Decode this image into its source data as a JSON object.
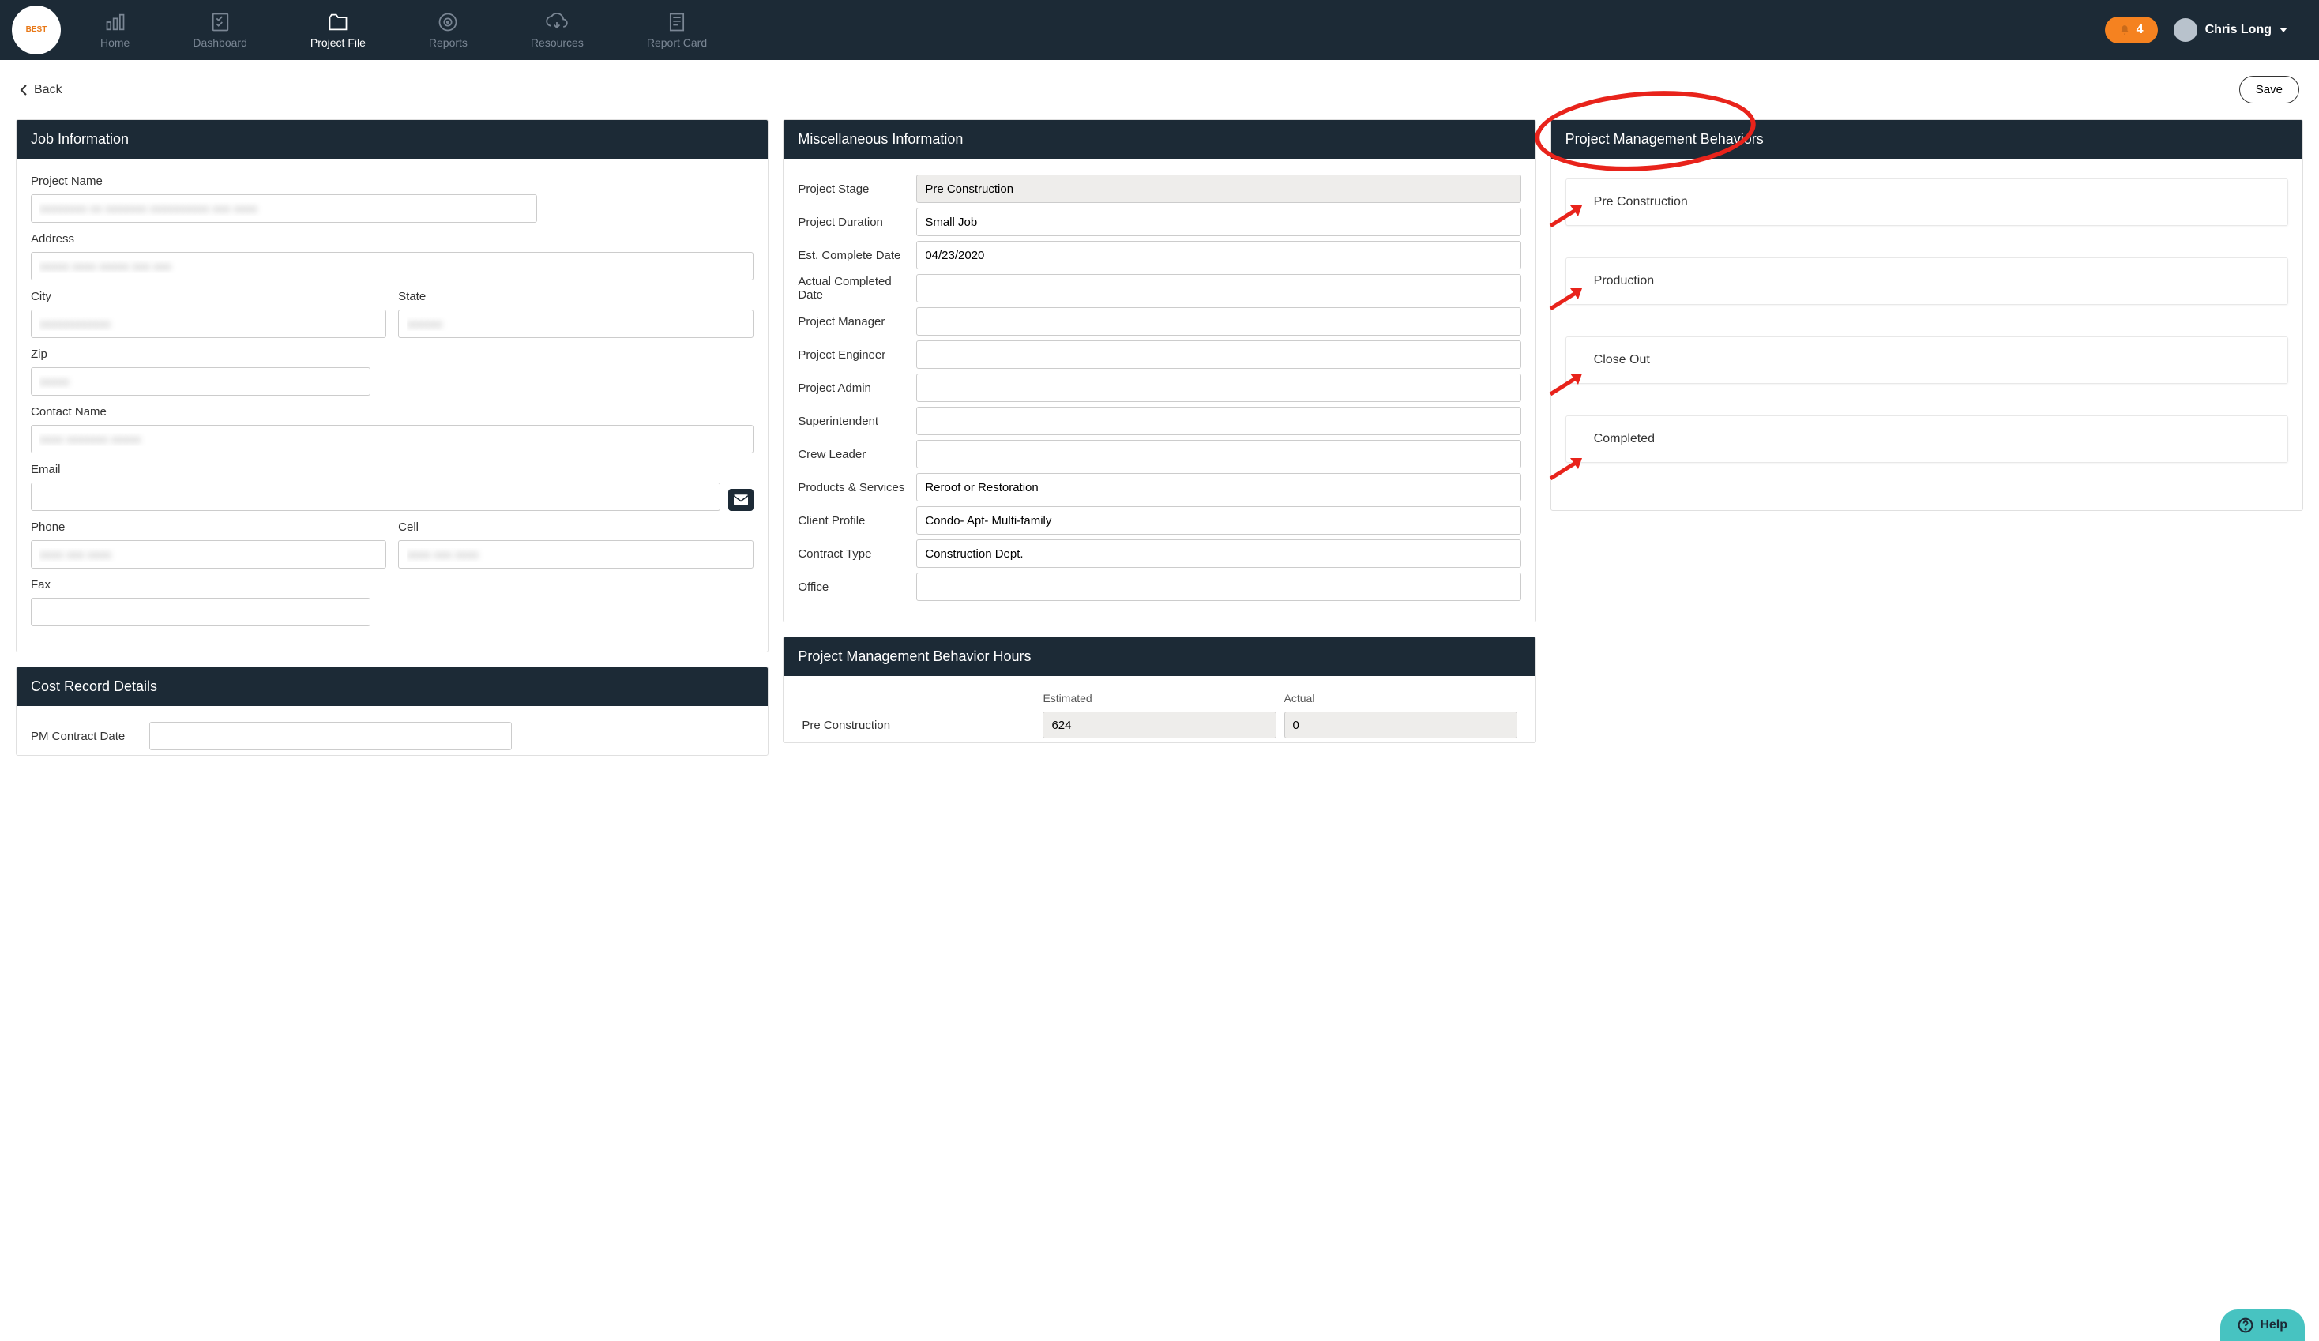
{
  "header": {
    "nav": [
      {
        "label": "Home",
        "active": false
      },
      {
        "label": "Dashboard",
        "active": false
      },
      {
        "label": "Project File",
        "active": true
      },
      {
        "label": "Reports",
        "active": false
      },
      {
        "label": "Resources",
        "active": false
      },
      {
        "label": "Report Card",
        "active": false
      }
    ],
    "notification_count": "4",
    "user_name": "Chris Long"
  },
  "back_label": "Back",
  "save_label": "Save",
  "cards": {
    "job_info": {
      "title": "Job Information",
      "labels": {
        "project_name": "Project Name",
        "address": "Address",
        "city": "City",
        "state": "State",
        "zip": "Zip",
        "contact_name": "Contact Name",
        "email": "Email",
        "phone": "Phone",
        "cell": "Cell",
        "fax": "Fax"
      }
    },
    "cost_record": {
      "title": "Cost Record Details",
      "labels": {
        "pm_contract_date": "PM Contract Date"
      }
    },
    "misc": {
      "title": "Miscellaneous Information",
      "rows": [
        {
          "label": "Project Stage",
          "value": "Pre Construction",
          "readonly": true
        },
        {
          "label": "Project Duration",
          "value": "Small Job"
        },
        {
          "label": "Est. Complete Date",
          "value": "04/23/2020"
        },
        {
          "label": "Actual Completed Date",
          "value": ""
        },
        {
          "label": "Project Manager",
          "value": ""
        },
        {
          "label": "Project Engineer",
          "value": ""
        },
        {
          "label": "Project Admin",
          "value": ""
        },
        {
          "label": "Superintendent",
          "value": ""
        },
        {
          "label": "Crew Leader",
          "value": ""
        },
        {
          "label": "Products & Services",
          "value": "Reroof or Restoration"
        },
        {
          "label": "Client Profile",
          "value": "Condo- Apt- Multi-family"
        },
        {
          "label": "Contract Type",
          "value": "Construction Dept."
        },
        {
          "label": "Office",
          "value": ""
        }
      ]
    },
    "pm_hours": {
      "title": "Project Management Behavior Hours",
      "col_estimated": "Estimated",
      "col_actual": "Actual",
      "rows": [
        {
          "label": "Pre Construction",
          "estimated": "624",
          "actual": "0"
        }
      ]
    },
    "pm_behaviors": {
      "title": "Project Management Behaviors",
      "items": [
        "Pre Construction",
        "Production",
        "Close Out",
        "Completed"
      ]
    }
  },
  "help_label": "Help"
}
